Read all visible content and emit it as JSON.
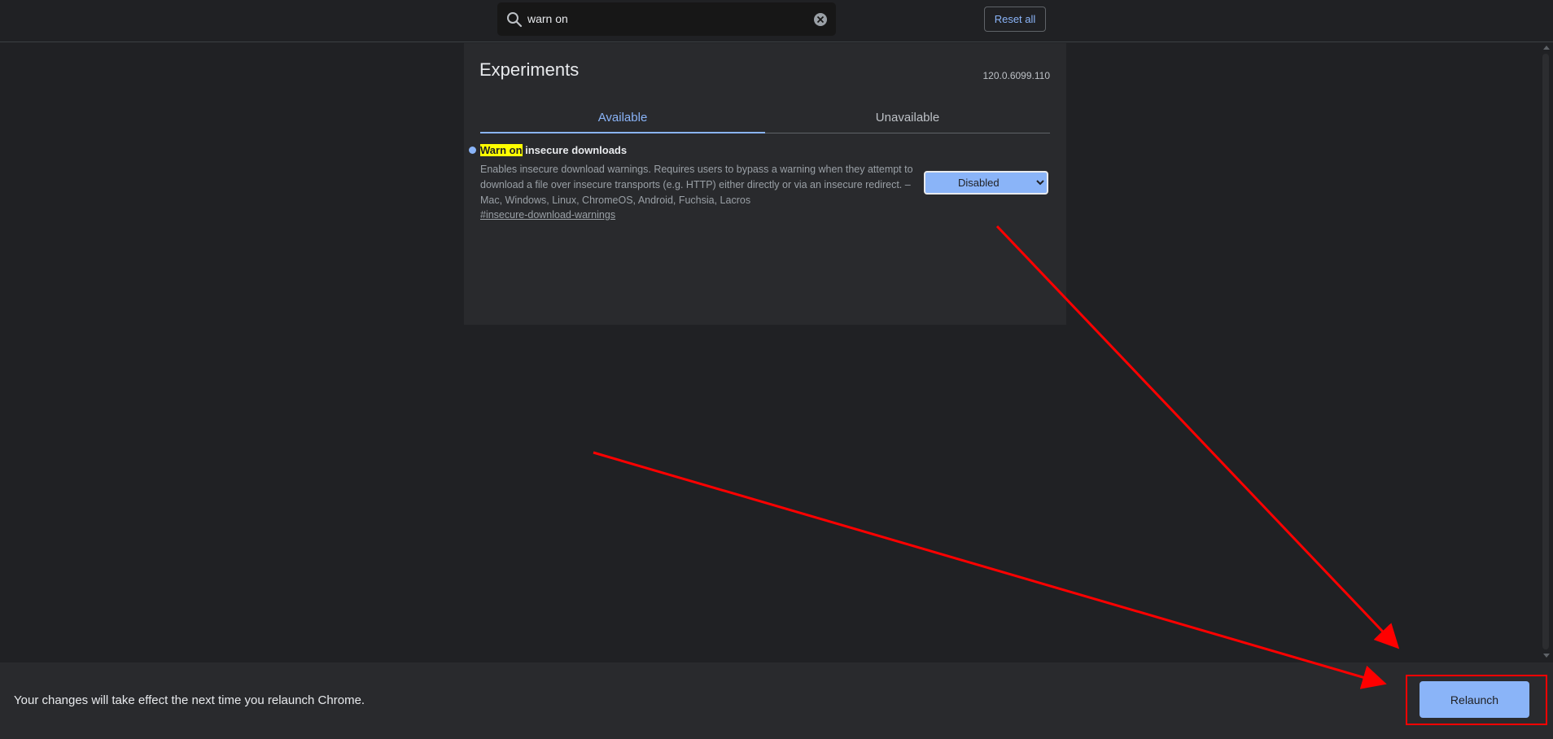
{
  "header": {
    "search": {
      "value": "warn on",
      "icon": "search-icon",
      "clear_icon": "clear-icon"
    },
    "reset_all_label": "Reset all"
  },
  "main": {
    "title": "Experiments",
    "version": "120.0.6099.110",
    "tabs": [
      {
        "label": "Available",
        "selected": true
      },
      {
        "label": "Unavailable",
        "selected": false
      }
    ],
    "flag": {
      "title_highlight": "Warn on",
      "title_rest": " insecure downloads",
      "description": "Enables insecure download warnings. Requires users to bypass a warning when they attempt to download a file over insecure transports (e.g. HTTP) either directly or via an insecure redirect. – Mac, Windows, Linux, ChromeOS, Android, Fuchsia, Lacros",
      "link": "#insecure-download-warnings",
      "selected_option": "Disabled"
    }
  },
  "footer": {
    "message": "Your changes will take effect the next time you relaunch Chrome.",
    "relaunch_label": "Relaunch"
  },
  "colors": {
    "background": "#202124",
    "panel": "#292a2d",
    "accent": "#8ab4f8",
    "highlight": "#ffff00",
    "annotation": "#ff0000"
  }
}
